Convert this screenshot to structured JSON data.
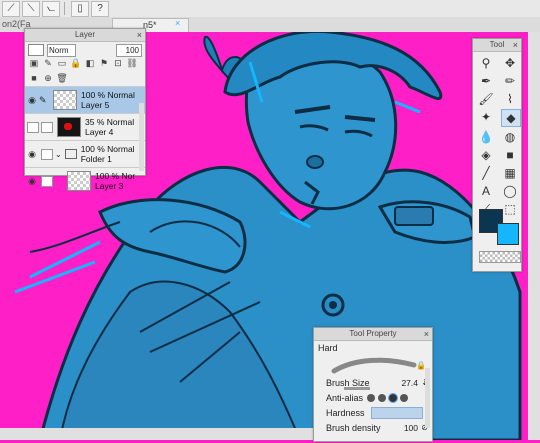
{
  "tabs": {
    "file_tab": "on2(Fa",
    "active_tab": "n5*"
  },
  "layer_panel": {
    "title": "Layer",
    "blend_mode": "Norm",
    "opacity": "100",
    "layers": [
      {
        "opacity_mode": "100 % Normal",
        "name": "Layer 5"
      },
      {
        "opacity_mode": "35 % Normal",
        "name": "Layer 4"
      },
      {
        "opacity_mode": "100 % Normal",
        "name": "Folder 1"
      },
      {
        "opacity_mode": "100 % Nor",
        "name": "Layer 3"
      }
    ]
  },
  "tool_panel": {
    "title": "Tool"
  },
  "tool_property": {
    "title": "Tool Property",
    "tool_name": "Hard",
    "brush_size_label": "Brush Size",
    "brush_size_value": "27.4",
    "anti_alias_label": "Anti-alias",
    "hardness_label": "Hardness",
    "brush_density_label": "Brush density",
    "brush_density_value": "100"
  },
  "colors": {
    "main": "#0b3550",
    "sub": "#16b6ff",
    "canvas_bg": "#ff1fc7",
    "ink": "#1e90c8"
  }
}
